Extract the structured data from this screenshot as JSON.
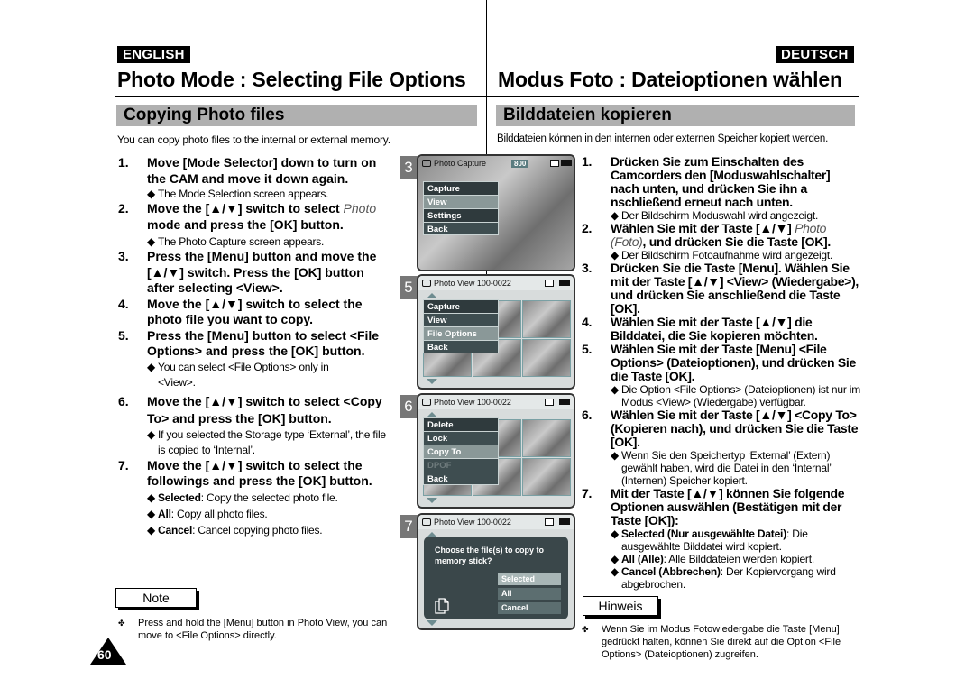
{
  "english": {
    "lang_label": "ENGLISH",
    "title": "Photo Mode : Selecting File Options",
    "section": "Copying Photo files",
    "intro": "You can copy photo files to the internal or external memory.",
    "steps": [
      {
        "num": "1.",
        "text": "Move [Mode Selector] down to turn on the CAM and move it down again.",
        "subs": [
          "The Mode Selection screen appears."
        ]
      },
      {
        "num": "2.",
        "text_italic": "Photo",
        "text": " mode and press the [OK] button.",
        "prefix": "Move the [▲/▼] switch to select ",
        "subs": [
          "The Photo Capture screen appears."
        ]
      },
      {
        "num": "3.",
        "text": "Press the [Menu] button and move the [▲/▼] switch. Press the [OK] button after selecting <View>.",
        "subs": []
      },
      {
        "num": "4.",
        "text": "Move the [▲/▼] switch to select the photo file you want to copy.",
        "subs": []
      },
      {
        "num": "5.",
        "text": "Press the [Menu] button to select <File Options> and press the [OK] button.",
        "subs": [
          "You can select <File Options> only in <View>."
        ]
      },
      {
        "num": "6.",
        "text": "Move the [▲/▼] switch to select <Copy To> and press the [OK] button.",
        "subs": [
          "If you selected the Storage type ‘External’, the file is copied to ‘Internal’."
        ]
      },
      {
        "num": "7.",
        "text": "Move the [▲/▼] switch to select the followings and press the [OK] button.",
        "subs": []
      }
    ],
    "options": [
      {
        "term": "Selected",
        "desc": ": Copy the selected photo file."
      },
      {
        "term": "All",
        "desc": ": Copy all photo files."
      },
      {
        "term": "Cancel",
        "desc": ": Cancel copying photo files."
      }
    ],
    "note_label": "Note",
    "note_text": "Press and hold the [Menu] button in Photo View, you can move to <File Options> directly.",
    "bullet": "◆",
    "note_bullet": "✤",
    "page_number": "60"
  },
  "deutsch": {
    "lang_label": "DEUTSCH",
    "title": "Modus Foto : Dateioptionen wählen",
    "section": "Bilddateien kopieren",
    "intro": "Bilddateien können in den internen oder externen Speicher kopiert werden.",
    "steps": [
      {
        "num": "1.",
        "text": "Drücken Sie zum Einschalten des Camcorders den [Moduswahlschalter] nach unten, und drücken Sie ihn a nschließend erneut nach unten.",
        "subs": [
          "Der Bildschirm Moduswahl wird angezeigt."
        ]
      },
      {
        "num": "2.",
        "prefix": "Wählen Sie mit der Taste [▲/▼] ",
        "text_italic": "Photo (Foto)",
        "text": ", und drücken Sie die Taste [OK].",
        "subs": [
          "Der Bildschirm Fotoaufnahme wird angezeigt."
        ]
      },
      {
        "num": "3.",
        "text": "Drücken Sie die Taste [Menu]. Wählen Sie mit der Taste [▲/▼] <View> (Wiedergabe>), und drücken Sie anschließend die Taste [OK].",
        "subs": []
      },
      {
        "num": "4.",
        "text": "Wählen Sie mit der Taste [▲/▼] die Bilddatei, die Sie kopieren möchten.",
        "subs": []
      },
      {
        "num": "5.",
        "text": "Wählen Sie mit der Taste [Menu] <File Options> (Dateioptionen), und drücken Sie die Taste [OK].",
        "subs": [
          "Die Option <File Options> (Dateioptionen) ist nur im Modus <View> (Wiedergabe) verfügbar."
        ]
      },
      {
        "num": "6.",
        "text": "Wählen Sie mit der Taste [▲/▼] <Copy To> (Kopieren nach), und drücken Sie die Taste [OK].",
        "subs": [
          "Wenn Sie den Speichertyp ‘External’ (Extern) gewählt haben, wird die Datei in den ‘Internal’ (Internen) Speicher kopiert."
        ]
      },
      {
        "num": "7.",
        "text": "Mit der Taste [▲/▼] können Sie folgende Optionen auswählen (Bestätigen mit der Taste [OK]):",
        "subs": []
      }
    ],
    "options": [
      {
        "term": "Selected (Nur ausgewählte Datei)",
        "desc": ": Die ausgewählte Bilddatei wird kopiert."
      },
      {
        "term": "All (Alle)",
        "desc": ": Alle Bilddateien werden kopiert."
      },
      {
        "term": "Cancel (Abbrechen)",
        "desc": ": Der Kopiervorgang wird abgebrochen."
      }
    ],
    "note_label": "Hinweis",
    "note_text": "Wenn Sie im Modus Fotowiedergabe die Taste [Menu] gedrückt halten, können Sie direkt auf die Option <File Options> (Dateioptionen) zugreifen."
  },
  "screens": [
    {
      "step": "3",
      "header": "Photo Capture",
      "badge": "800",
      "menu": [
        "Capture",
        "View",
        "Settings",
        "Back"
      ],
      "selected": "View"
    },
    {
      "step": "5",
      "header": "Photo View  100-0022",
      "menu": [
        "Capture",
        "View",
        "File Options",
        "Back"
      ],
      "selected": "File Options"
    },
    {
      "step": "6",
      "header": "Photo View  100-0022",
      "menu": [
        "Delete",
        "Lock",
        "Copy To",
        "DPOF",
        "Back"
      ],
      "selected": "Copy To",
      "disabled": "DPOF"
    },
    {
      "step": "7",
      "header": "Photo View  100-0022",
      "dialog": {
        "question": "Choose the file(s) to copy to memory stick?",
        "options": [
          "Selected",
          "All",
          "Cancel"
        ],
        "selected": "Selected"
      }
    }
  ],
  "colors": {
    "section_bar": "#b0b0b0",
    "menu_bg": "#2f3a3d",
    "menu_selected": "#8a9898",
    "dialog_bg": "#3a474a"
  }
}
